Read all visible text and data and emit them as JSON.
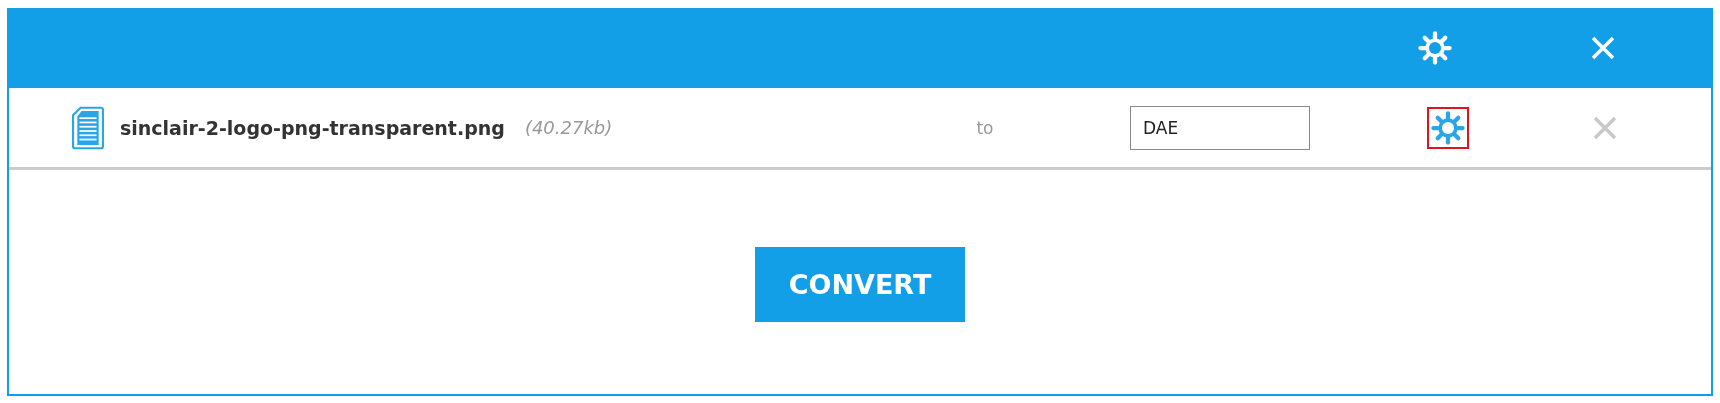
{
  "files": [
    {
      "name": "sinclair-2-logo-png-transparent.png",
      "size": "(40.27kb)",
      "to_label": "to",
      "format": "DAE",
      "settings_highlighted": true
    }
  ],
  "convert_button": {
    "label": "CONVERT"
  }
}
